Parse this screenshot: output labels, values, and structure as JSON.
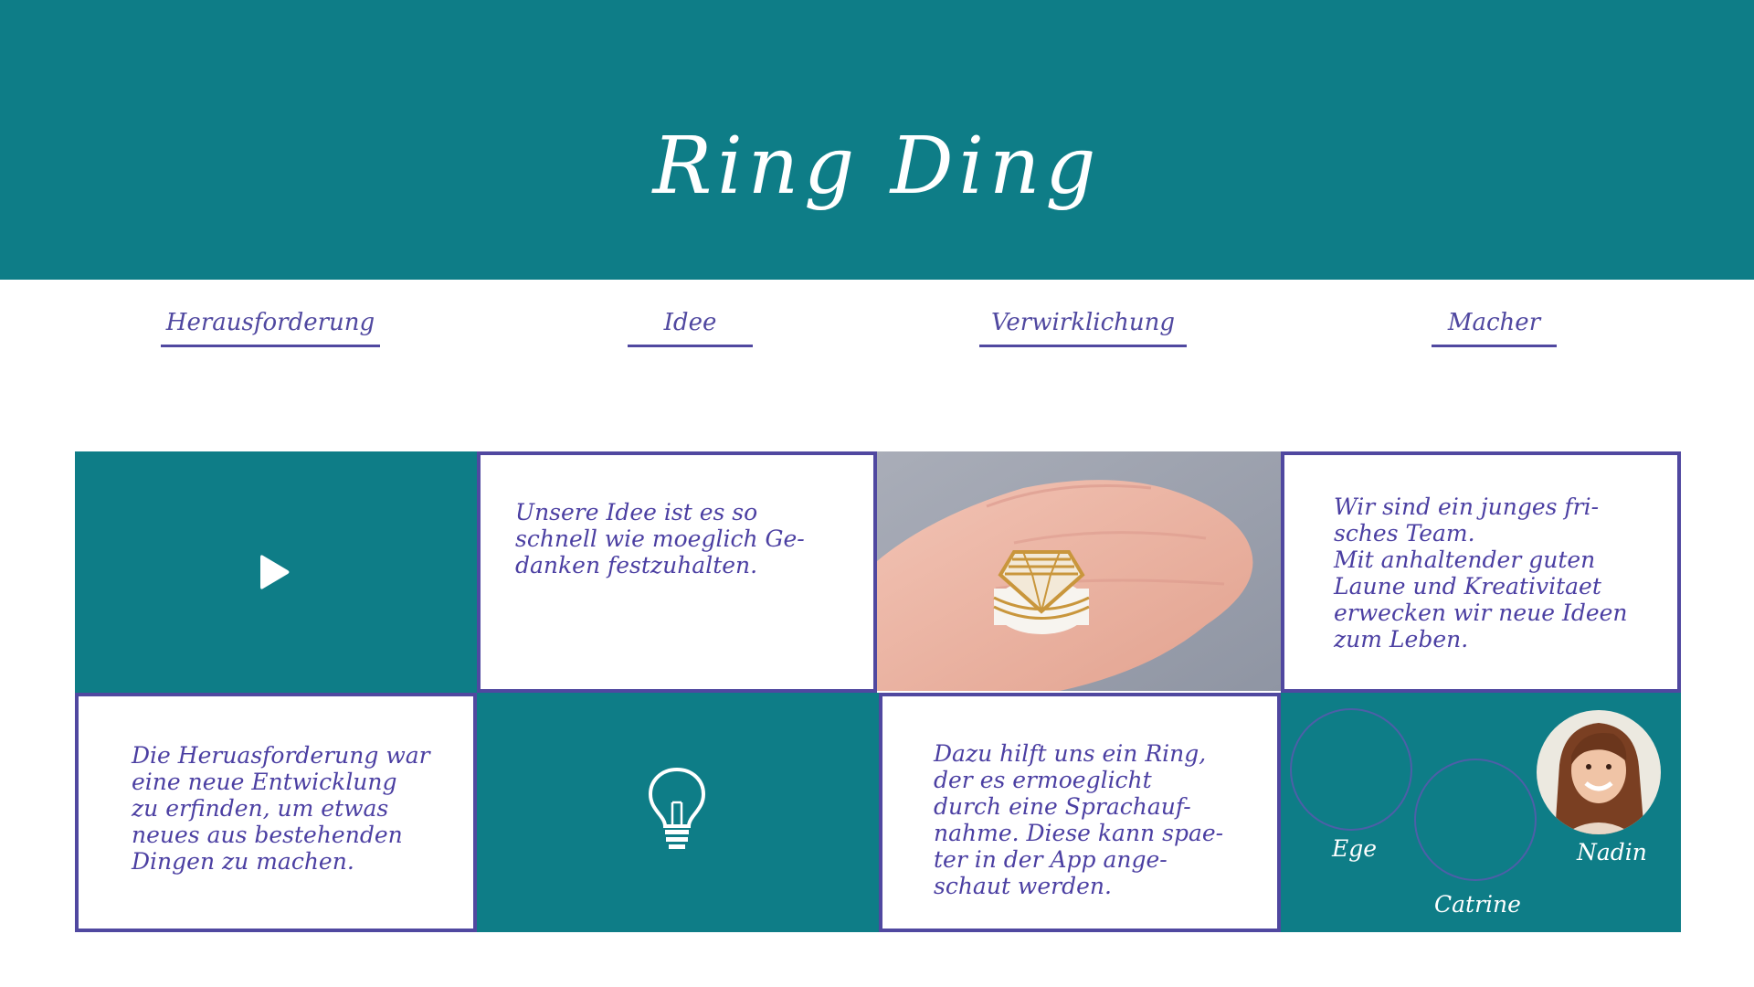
{
  "header": {
    "title": "Ring Ding"
  },
  "nav": [
    {
      "label": "Herausforderung"
    },
    {
      "label": "Idee"
    },
    {
      "label": "Verwirklichung"
    },
    {
      "label": "Macher"
    }
  ],
  "tiles": {
    "idee_text": "Unsere Idee ist es so\nschnell wie moeglich Ge-\ndanken festzuhalten.",
    "macher_text": "Wir sind ein junges fri-\nsches Team.\nMit anhaltender guten\nLaune und Kreativitaet\nerwecken wir neue Ideen\nzum Leben.",
    "herausforderung_text": "Die Heruasforderung war\neine neue Entwicklung\nzu erfinden, um etwas\nneues aus bestehenden\nDingen zu machen.",
    "verwirklichung_text": "Dazu hilft uns ein Ring,\nder es ermoeglicht\ndurch eine Sprachauf-\nnahme. Diese kann spae-\nter in der App ange-\nschaut werden."
  },
  "team": {
    "members": [
      "Ege",
      "Catrine",
      "Nadin"
    ]
  },
  "icons": {
    "video": "play-icon",
    "idea": "lightbulb-icon"
  },
  "colors": {
    "teal": "#0e7d87",
    "purple": "#5048a0",
    "white": "#ffffff"
  }
}
